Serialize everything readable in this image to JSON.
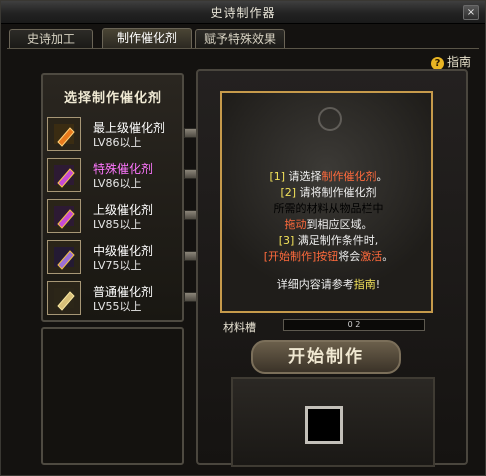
{
  "window": {
    "title": "史诗制作器",
    "close_label": "×"
  },
  "tabs": [
    {
      "label": "史诗加工",
      "active": false
    },
    {
      "label": "制作催化剂",
      "active": true
    },
    {
      "label": "赋予特殊效果",
      "active": false
    }
  ],
  "help": {
    "icon": "question-icon",
    "label": "指南"
  },
  "left": {
    "header": "选择制作催化剂",
    "items": [
      {
        "name": "最上级催化剂",
        "level": "LV86以上",
        "color": "#ffffff",
        "icon_color": "#e87a1c"
      },
      {
        "name": "特殊催化剂",
        "level": "LV86以上",
        "color": "#ff76ff",
        "icon_color": "#c84bd6"
      },
      {
        "name": "上级催化剂",
        "level": "LV85以上",
        "color": "#ffffff",
        "icon_color": "#c84bd6"
      },
      {
        "name": "中级催化剂",
        "level": "LV75以上",
        "color": "#ffffff",
        "icon_color": "#9b6fd6"
      },
      {
        "name": "普通催化剂",
        "level": "LV55以上",
        "color": "#ffffff",
        "icon_color": "#d8c07a"
      }
    ]
  },
  "info": {
    "l1a": "[1] ",
    "l1b": "请选择",
    "l1c": "制作催化剂",
    "l1d": "。",
    "l2a": "[2] ",
    "l2b": "请将制作催化剂",
    "l3": "所需的材料从物品栏中",
    "l4a": "拖动",
    "l4b": "到相应区域。",
    "l5a": "[3] ",
    "l5b": "满足制作条件时,",
    "l6a": "[开始制作]按钮",
    "l6b": "将会",
    "l6c": "激活",
    "l6d": "。",
    "l7a": "详细内容请参考",
    "l7b": "指南",
    "l7c": "!"
  },
  "material": {
    "label": "材料槽",
    "value": "0 2"
  },
  "start_button": "开始制作",
  "colors": {
    "accent_gold": "#c69a4b",
    "yellow_text": "#f2e25a",
    "red_text": "#ff6a3c"
  }
}
